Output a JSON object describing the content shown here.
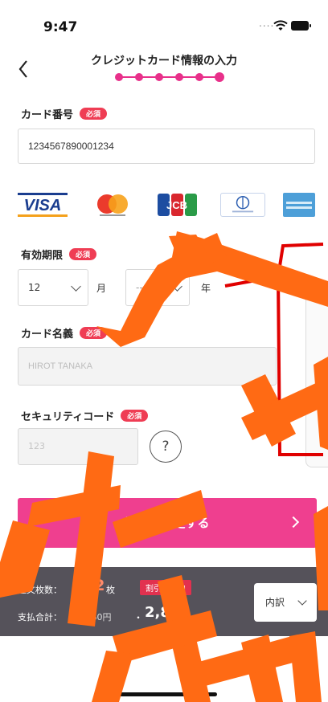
{
  "status_bar": {
    "time": "9:47",
    "signal_dots": "....",
    "icons": [
      "wifi-icon",
      "battery-icon"
    ]
  },
  "nav": {
    "title": "クレジットカード情報の入力",
    "back_icon": "chevron-left-icon",
    "steps_total": 6,
    "steps_current": 6,
    "accent_color": "#e8308a"
  },
  "form": {
    "required_badge": "必須",
    "card_number": {
      "label": "カード番号",
      "value": "1234567890001234"
    },
    "card_brands": [
      "VISA",
      "Mastercard",
      "JCB",
      "Diners Club",
      "American Express"
    ],
    "expiry": {
      "label": "有効期限",
      "month_value": "12",
      "month_unit": "月",
      "year_value": "----",
      "year_unit": "年"
    },
    "card_name": {
      "label": "カード名義",
      "placeholder": "HIROT TANAKA"
    },
    "security_code": {
      "label": "セキュリティコード",
      "placeholder": "123",
      "help_symbol": "?"
    }
  },
  "confirm": {
    "label": "注文を確定する",
    "color": "#ef3f8f"
  },
  "summary": {
    "order_count_label": "注文枚数：",
    "order_count": "12",
    "order_count_unit": "枚",
    "discount_badge": "割引適用中",
    "total_label": "支払合計：",
    "old_price": "3,060",
    "old_price_unit": "円",
    "separator": "・",
    "new_price": "2,844",
    "new_price_unit": "円",
    "breakdown_label": "内訳",
    "background_color": "#55525a"
  },
  "overlay": {
    "watermark_color": "#ff6a14",
    "marker_color": "#e00000"
  }
}
